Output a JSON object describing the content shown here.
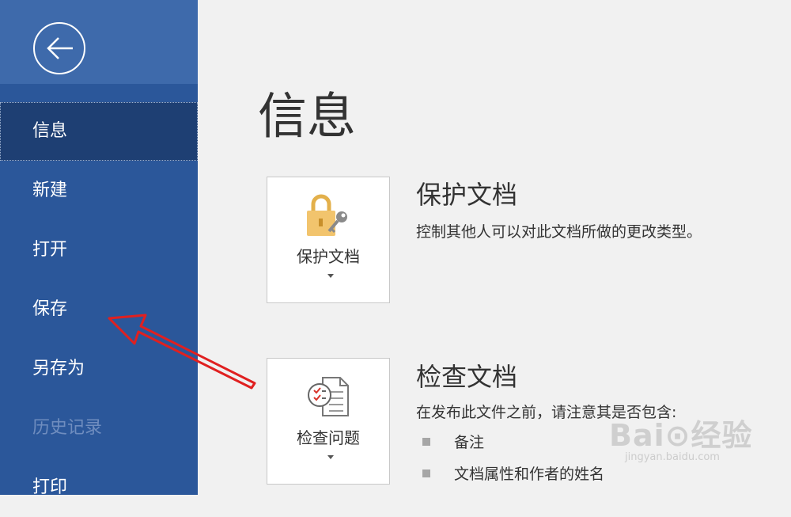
{
  "sidebar": {
    "items": [
      {
        "label": "信息",
        "state": "active"
      },
      {
        "label": "新建",
        "state": "normal"
      },
      {
        "label": "打开",
        "state": "normal"
      },
      {
        "label": "保存",
        "state": "normal"
      },
      {
        "label": "另存为",
        "state": "normal"
      },
      {
        "label": "历史记录",
        "state": "disabled"
      },
      {
        "label": "打印",
        "state": "normal"
      }
    ]
  },
  "main": {
    "title": "信息",
    "sections": [
      {
        "tile_label": "保护文档",
        "tile_icon": "lock-key-icon",
        "title": "保护文档",
        "description": "控制其他人可以对此文档所做的更改类型。"
      },
      {
        "tile_label": "检查问题",
        "tile_icon": "inspect-document-icon",
        "title": "检查文档",
        "description": "在发布此文件之前，请注意其是否包含:",
        "bullets": [
          "备注",
          "文档属性和作者的姓名"
        ]
      }
    ]
  },
  "watermark": {
    "brand": "Bai⊙经验",
    "url": "jingyan.baidu.com"
  },
  "colors": {
    "sidebar": "#2b579a",
    "sidebar_active": "#1e3f73",
    "annotation_arrow": "#e02020"
  }
}
